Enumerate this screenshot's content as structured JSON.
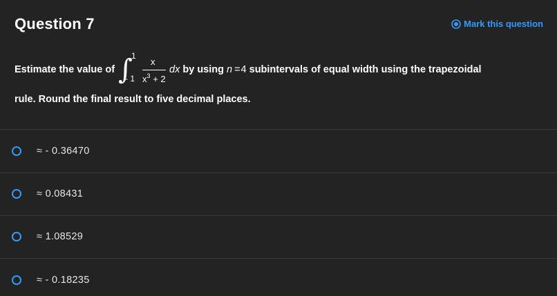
{
  "header": {
    "title": "Question 7",
    "mark_label": "Mark this question",
    "accent_color": "#2f9bff"
  },
  "question": {
    "prefix": "Estimate the value of",
    "integral": {
      "upper": "1",
      "lower": "- 1",
      "numerator": "x",
      "denominator_base": "x",
      "denominator_exp": "3",
      "denominator_rest": "+ 2",
      "differential": "dx"
    },
    "text_by_using": "by using",
    "n_var": "n",
    "equals": "=",
    "n_value": "4",
    "text_after": "subintervals of equal width using the trapezoidal",
    "line2": "rule. Round the final result to five decimal places."
  },
  "options": [
    {
      "label": "≈ - 0.36470"
    },
    {
      "label": "≈ 0.08431"
    },
    {
      "label": "≈ 1.08529"
    },
    {
      "label": "≈ - 0.18235"
    }
  ]
}
